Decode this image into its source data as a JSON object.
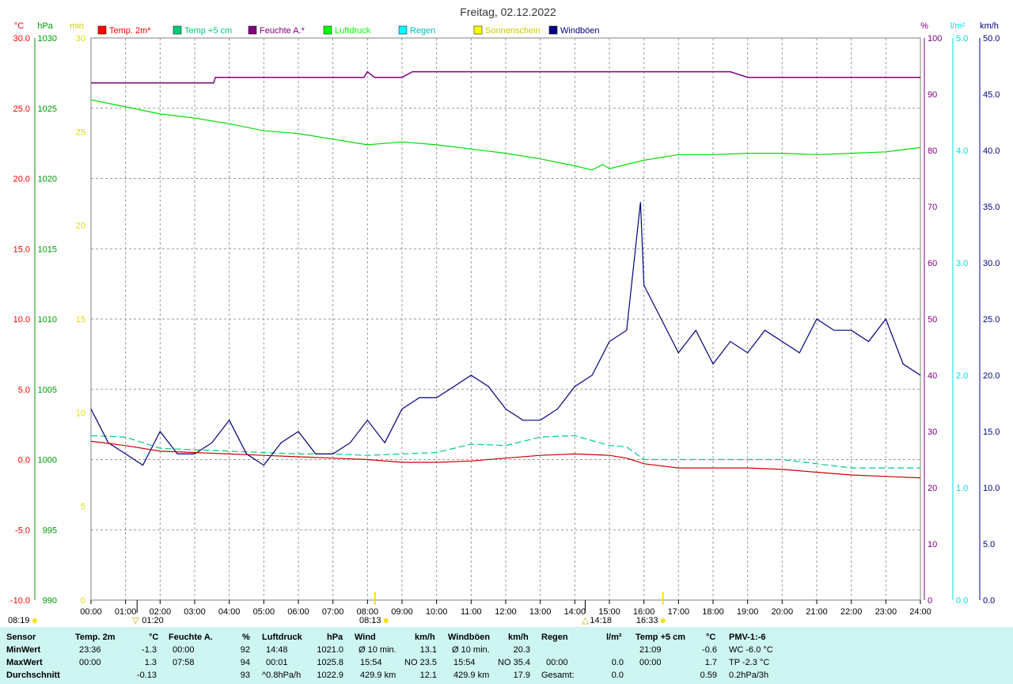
{
  "chart_data": {
    "type": "line",
    "title": "Freitag, 02.12.2022",
    "x_ticks": [
      "00:00",
      "01:00",
      "02:00",
      "03:00",
      "04:00",
      "05:00",
      "06:00",
      "07:00",
      "08:00",
      "09:00",
      "10:00",
      "11:00",
      "12:00",
      "13:00",
      "14:00",
      "15:00",
      "16:00",
      "17:00",
      "18:00",
      "19:00",
      "20:00",
      "21:00",
      "22:00",
      "23:00",
      "24:00"
    ],
    "axes": {
      "temp": {
        "unit": "°C",
        "range": [
          -10,
          30
        ],
        "ticks": [
          "30.0",
          "25.0",
          "20.0",
          "15.0",
          "10.0",
          "5.0",
          "0.0",
          "-5.0",
          "-10.0"
        ],
        "color": "#ff0000"
      },
      "pressure": {
        "unit": "hPa",
        "range": [
          990,
          1030
        ],
        "ticks": [
          "1030",
          "1025",
          "1020",
          "1015",
          "1010",
          "1005",
          "1000",
          "995",
          "990"
        ],
        "color": "#009900"
      },
      "sunshine": {
        "unit": "min",
        "range": [
          0,
          30
        ],
        "ticks": [
          "30",
          "25",
          "20",
          "15",
          "10",
          "5",
          "0"
        ],
        "color": "#ffff00"
      },
      "humidity": {
        "unit": "%",
        "range": [
          0,
          100
        ],
        "ticks": [
          "100",
          "90",
          "80",
          "70",
          "60",
          "50",
          "40",
          "30",
          "20",
          "10",
          "0"
        ],
        "color": "#800080"
      },
      "rain": {
        "unit": "l/m²",
        "range": [
          0,
          5
        ],
        "ticks": [
          "5.0",
          "4.0",
          "3.0",
          "2.0",
          "1.0",
          "0.0"
        ],
        "color": "#00ffff"
      },
      "wind": {
        "unit": "km/h",
        "range": [
          0,
          50
        ],
        "ticks": [
          "50.0",
          "45.0",
          "40.0",
          "35.0",
          "30.0",
          "25.0",
          "20.0",
          "15.0",
          "10.0",
          "5.0",
          "0.0"
        ],
        "color": "#000080"
      }
    },
    "legend": [
      {
        "name": "Temp. 2m*",
        "color": "#ff0000"
      },
      {
        "name": "Temp +5 cm",
        "color": "#00cc77"
      },
      {
        "name": "Feuchte A.*",
        "color": "#800080"
      },
      {
        "name": "Luftdruck",
        "color": "#00ff00"
      },
      {
        "name": "Regen",
        "color": "#00ffff"
      },
      {
        "name": "Sonnenschein",
        "color": "#ffff00"
      },
      {
        "name": "Windböen",
        "color": "#000080"
      }
    ],
    "series": [
      {
        "name": "Temp. 2m*",
        "axis": "temp",
        "x": [
          0,
          1,
          2,
          3,
          4,
          5,
          6,
          7,
          8,
          9,
          10,
          11,
          12,
          13,
          14,
          15,
          15.5,
          16,
          17,
          18,
          19,
          20,
          21,
          22,
          23,
          24
        ],
        "values": [
          1.3,
          1.0,
          0.6,
          0.5,
          0.4,
          0.3,
          0.2,
          0.1,
          0.0,
          -0.2,
          -0.2,
          -0.1,
          0.1,
          0.3,
          0.4,
          0.3,
          0.1,
          -0.3,
          -0.6,
          -0.6,
          -0.6,
          -0.7,
          -0.9,
          -1.1,
          -1.2,
          -1.3
        ]
      },
      {
        "name": "Temp +5 cm",
        "axis": "temp",
        "x": [
          0,
          1,
          2,
          3,
          4,
          5,
          6,
          7,
          8,
          9,
          10,
          11,
          12,
          13,
          14,
          15,
          15.5,
          16,
          17,
          18,
          19,
          20,
          21,
          22,
          23,
          24
        ],
        "values": [
          1.7,
          1.6,
          0.8,
          0.7,
          0.6,
          0.5,
          0.4,
          0.4,
          0.3,
          0.4,
          0.5,
          1.1,
          1.0,
          1.6,
          1.7,
          1.0,
          0.9,
          0.0,
          0.0,
          0.0,
          0.0,
          0.0,
          -0.3,
          -0.6,
          -0.6,
          -0.6
        ]
      },
      {
        "name": "Feuchte A.*",
        "axis": "humidity",
        "x": [
          0,
          1,
          2,
          3,
          3.55,
          3.6,
          4,
          5,
          6,
          7,
          7.9,
          8,
          8.2,
          9,
          9.3,
          10,
          11,
          12,
          13,
          14,
          15,
          16,
          17,
          18,
          18.5,
          19,
          20,
          21,
          22,
          23,
          24
        ],
        "values": [
          92,
          92,
          92,
          92,
          92,
          93,
          93,
          93,
          93,
          93,
          93,
          94,
          93,
          93,
          94,
          94,
          94,
          94,
          94,
          94,
          94,
          94,
          94,
          94,
          94,
          93,
          93,
          93,
          93,
          93,
          93
        ]
      },
      {
        "name": "Luftdruck",
        "axis": "pressure",
        "x": [
          0,
          1,
          2,
          3,
          4,
          5,
          6,
          7,
          8,
          9,
          10,
          11,
          12,
          13,
          14,
          14.5,
          14.8,
          15,
          16,
          17,
          18,
          19,
          20,
          21,
          22,
          23,
          24
        ],
        "values": [
          1025.6,
          1025.1,
          1024.6,
          1024.3,
          1023.9,
          1023.4,
          1023.2,
          1022.8,
          1022.4,
          1022.6,
          1022.4,
          1022.1,
          1021.8,
          1021.4,
          1020.9,
          1020.6,
          1021.0,
          1020.7,
          1021.3,
          1021.7,
          1021.7,
          1021.8,
          1021.8,
          1021.7,
          1021.8,
          1021.9,
          1022.2
        ]
      },
      {
        "name": "Windböen",
        "axis": "wind",
        "x": [
          0,
          0.5,
          1,
          1.5,
          2,
          2.5,
          3,
          3.5,
          4,
          4.5,
          5,
          5.5,
          6,
          6.5,
          7,
          7.5,
          8,
          8.5,
          9,
          9.5,
          10,
          10.5,
          11,
          11.5,
          12,
          12.5,
          13,
          13.5,
          14,
          14.5,
          15,
          15.5,
          15.9,
          16,
          16.5,
          17,
          17.5,
          18,
          18.5,
          19,
          19.5,
          20,
          20.5,
          21,
          21.5,
          22,
          22.5,
          23,
          23.5,
          24
        ],
        "values": [
          17,
          14,
          13,
          12,
          15,
          13,
          13,
          14,
          16,
          13,
          12,
          14,
          15,
          13,
          13,
          14,
          16,
          14,
          17,
          18,
          18,
          19,
          20,
          19,
          17,
          16,
          16,
          17,
          19,
          20,
          23,
          24,
          35.4,
          28,
          25,
          22,
          24,
          21,
          23,
          22,
          24,
          23,
          22,
          25,
          24,
          24,
          23,
          25,
          21,
          20
        ]
      }
    ],
    "markers": {
      "sunrise": "08:13",
      "sunset": "16:33",
      "moonset": "01:20",
      "moonrise": "14:18",
      "left_time": "08:19"
    }
  },
  "stats": {
    "header": {
      "sensor": "Sensor",
      "temp": "Temp. 2m",
      "temp_unit": "°C",
      "hum": "Feuchte A.",
      "hum_unit": "%",
      "press": "Luftdruck",
      "press_unit": "hPa",
      "wind": "Wind",
      "wind_unit": "km/h",
      "gust": "Windböen",
      "gust_unit": "km/h",
      "rain": "Regen",
      "rain_unit": "l/m²",
      "temp5": "Temp +5 cm",
      "temp5_unit": "°C",
      "pmv": "PMV-1:-6"
    },
    "min": {
      "label": "MinWert",
      "temp_time": "23:36",
      "temp_val": "-1.3",
      "hum_time": "00:00",
      "hum_val": "92",
      "press_time": "14:48",
      "press_val": "1021.0",
      "wind_a": "Ø 10 min.",
      "wind_val": "13.1",
      "gust_a": "Ø 10 min.",
      "gust_val": "20.3",
      "rain_time": "",
      "rain_val": "",
      "temp5_time": "21:09",
      "temp5_val": "-0.6",
      "pmv": "WC -6.0 °C"
    },
    "max": {
      "label": "MaxWert",
      "temp_time": "00:00",
      "temp_val": "1.3",
      "hum_time": "07:58",
      "hum_val": "94",
      "press_time": "00:01",
      "press_val": "1025.8",
      "wind_a": "15:54",
      "wind_b": "NO 23.5",
      "gust_a": "15:54",
      "gust_b": "NO 35.4",
      "rain_time": "00:00",
      "rain_val": "0.0",
      "temp5_time": "00:00",
      "temp5_val": "1.7",
      "pmv": "TP -2.3 °C"
    },
    "avg": {
      "label": "Durchschnitt",
      "temp_val": "-0.13",
      "hum_val": "93",
      "press_a": "^0.8hPa/h",
      "press_val": "1022.9",
      "wind_a": "429.9 km",
      "wind_val": "12.1",
      "gust_a": "429.9 km",
      "gust_val": "17.9",
      "rain_label": "Gesamt:",
      "rain_val": "0.0",
      "temp5_val": "0.59",
      "pmv": "0.2hPa/3h"
    }
  }
}
